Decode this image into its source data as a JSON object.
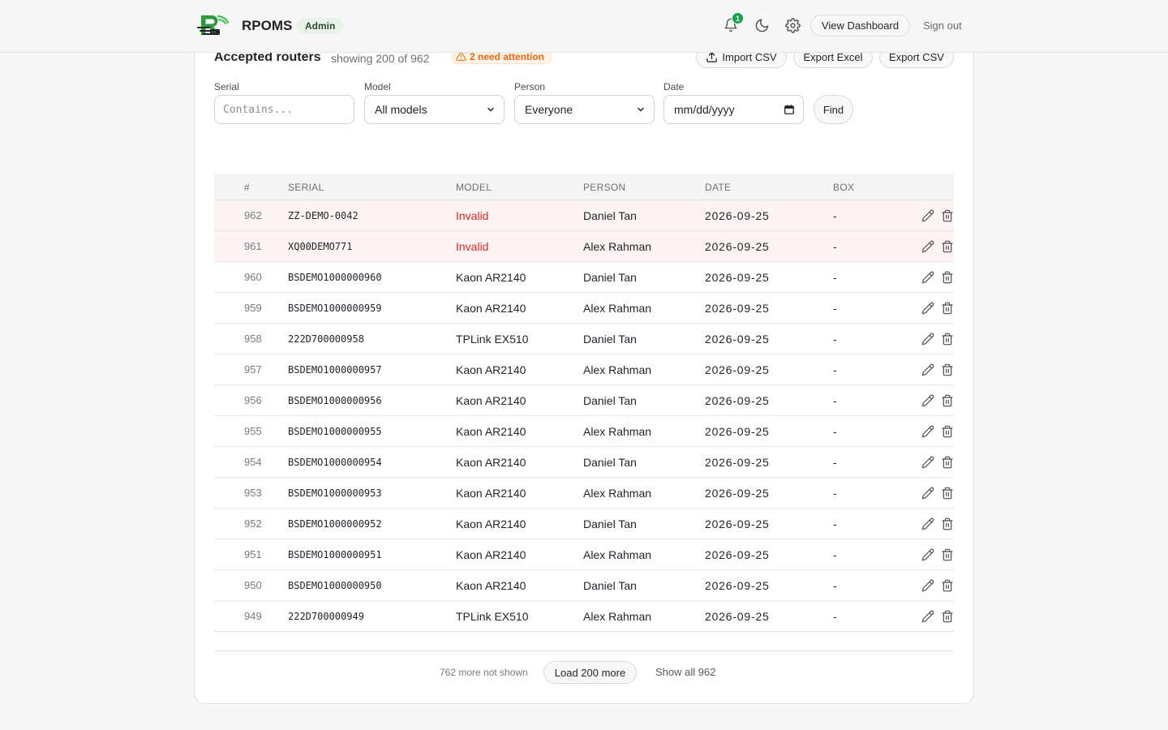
{
  "header": {
    "brand": "RPOMS",
    "role": "Admin",
    "notification_count": "1",
    "view_dashboard_label": "View Dashboard",
    "sign_out_label": "Sign out"
  },
  "card": {
    "title": "Accepted routers",
    "subtitle": "showing 200 of 962",
    "attention": "2 need attention",
    "import_label": "Import CSV",
    "export_excel_label": "Export Excel",
    "export_csv_label": "Export CSV"
  },
  "filters": {
    "serial_label": "Serial",
    "serial_placeholder": "Contains...",
    "model_label": "Model",
    "model_value": "All models",
    "person_label": "Person",
    "person_value": "Everyone",
    "date_label": "Date",
    "date_value": "mm/dd/yyyy",
    "find_label": "Find"
  },
  "table": {
    "columns": [
      "#",
      "SERIAL",
      "MODEL",
      "PERSON",
      "DATE",
      "BOX"
    ],
    "rows": [
      {
        "num": "962",
        "serial": "ZZ-DEMO-0042",
        "model": "Invalid",
        "person": "Daniel Tan",
        "date": "2026-09-25",
        "box": "-"
      },
      {
        "num": "961",
        "serial": "XQ00DEMO771",
        "model": "Invalid",
        "person": "Alex Rahman",
        "date": "2026-09-25",
        "box": "-"
      },
      {
        "num": "960",
        "serial": "BSDEMO1000000960",
        "model": "Kaon AR2140",
        "person": "Daniel Tan",
        "date": "2026-09-25",
        "box": "-"
      },
      {
        "num": "959",
        "serial": "BSDEMO1000000959",
        "model": "Kaon AR2140",
        "person": "Alex Rahman",
        "date": "2026-09-25",
        "box": "-"
      },
      {
        "num": "958",
        "serial": "222D700000958",
        "model": "TPLink EX510",
        "person": "Daniel Tan",
        "date": "2026-09-25",
        "box": "-"
      },
      {
        "num": "957",
        "serial": "BSDEMO1000000957",
        "model": "Kaon AR2140",
        "person": "Alex Rahman",
        "date": "2026-09-25",
        "box": "-"
      },
      {
        "num": "956",
        "serial": "BSDEMO1000000956",
        "model": "Kaon AR2140",
        "person": "Daniel Tan",
        "date": "2026-09-25",
        "box": "-"
      },
      {
        "num": "955",
        "serial": "BSDEMO1000000955",
        "model": "Kaon AR2140",
        "person": "Alex Rahman",
        "date": "2026-09-25",
        "box": "-"
      },
      {
        "num": "954",
        "serial": "BSDEMO1000000954",
        "model": "Kaon AR2140",
        "person": "Daniel Tan",
        "date": "2026-09-25",
        "box": "-"
      },
      {
        "num": "953",
        "serial": "BSDEMO1000000953",
        "model": "Kaon AR2140",
        "person": "Alex Rahman",
        "date": "2026-09-25",
        "box": "-"
      },
      {
        "num": "952",
        "serial": "BSDEMO1000000952",
        "model": "Kaon AR2140",
        "person": "Daniel Tan",
        "date": "2026-09-25",
        "box": "-"
      },
      {
        "num": "951",
        "serial": "BSDEMO1000000951",
        "model": "Kaon AR2140",
        "person": "Alex Rahman",
        "date": "2026-09-25",
        "box": "-"
      },
      {
        "num": "950",
        "serial": "BSDEMO1000000950",
        "model": "Kaon AR2140",
        "person": "Daniel Tan",
        "date": "2026-09-25",
        "box": "-"
      },
      {
        "num": "949",
        "serial": "222D700000949",
        "model": "TPLink EX510",
        "person": "Alex Rahman",
        "date": "2026-09-25",
        "box": "-"
      }
    ]
  },
  "footer": {
    "more_text": "762 more not shown",
    "load_more_label": "Load 200 more",
    "show_all_label": "Show all 962"
  },
  "colors": {
    "accent_green": "#16a34a",
    "invalid_red": "#dc2626",
    "attention_orange": "#e86a10",
    "invalid_row_bg": "#fff4f4"
  },
  "icons": [
    "logo-icon",
    "bell-icon",
    "moon-icon",
    "gear-icon",
    "warning-icon",
    "upload-icon",
    "chevron-down-icon",
    "calendar-icon",
    "pencil-icon",
    "trash-icon"
  ]
}
